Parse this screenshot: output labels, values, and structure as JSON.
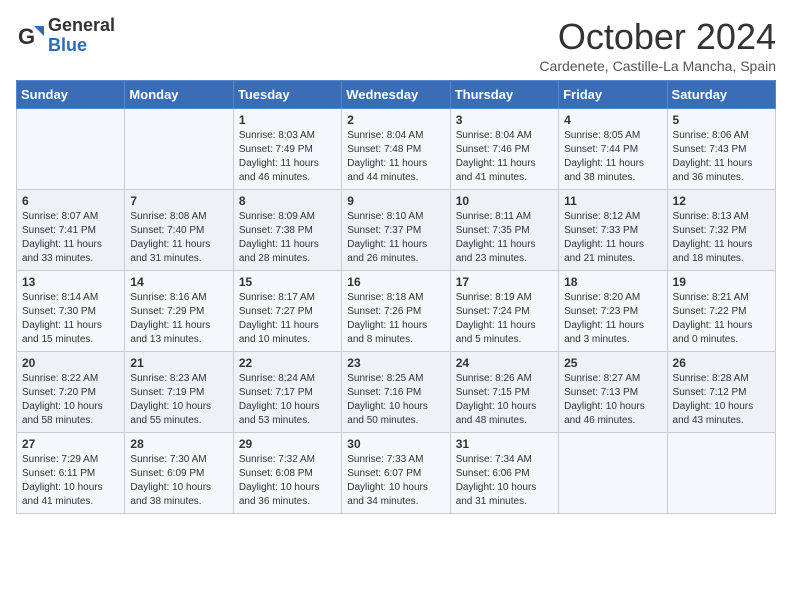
{
  "header": {
    "logo_general": "General",
    "logo_blue": "Blue",
    "month_title": "October 2024",
    "subtitle": "Cardenete, Castille-La Mancha, Spain"
  },
  "days_of_week": [
    "Sunday",
    "Monday",
    "Tuesday",
    "Wednesday",
    "Thursday",
    "Friday",
    "Saturday"
  ],
  "weeks": [
    [
      {
        "day": "",
        "info": ""
      },
      {
        "day": "",
        "info": ""
      },
      {
        "day": "1",
        "info": "Sunrise: 8:03 AM\nSunset: 7:49 PM\nDaylight: 11 hours and 46 minutes."
      },
      {
        "day": "2",
        "info": "Sunrise: 8:04 AM\nSunset: 7:48 PM\nDaylight: 11 hours and 44 minutes."
      },
      {
        "day": "3",
        "info": "Sunrise: 8:04 AM\nSunset: 7:46 PM\nDaylight: 11 hours and 41 minutes."
      },
      {
        "day": "4",
        "info": "Sunrise: 8:05 AM\nSunset: 7:44 PM\nDaylight: 11 hours and 38 minutes."
      },
      {
        "day": "5",
        "info": "Sunrise: 8:06 AM\nSunset: 7:43 PM\nDaylight: 11 hours and 36 minutes."
      }
    ],
    [
      {
        "day": "6",
        "info": "Sunrise: 8:07 AM\nSunset: 7:41 PM\nDaylight: 11 hours and 33 minutes."
      },
      {
        "day": "7",
        "info": "Sunrise: 8:08 AM\nSunset: 7:40 PM\nDaylight: 11 hours and 31 minutes."
      },
      {
        "day": "8",
        "info": "Sunrise: 8:09 AM\nSunset: 7:38 PM\nDaylight: 11 hours and 28 minutes."
      },
      {
        "day": "9",
        "info": "Sunrise: 8:10 AM\nSunset: 7:37 PM\nDaylight: 11 hours and 26 minutes."
      },
      {
        "day": "10",
        "info": "Sunrise: 8:11 AM\nSunset: 7:35 PM\nDaylight: 11 hours and 23 minutes."
      },
      {
        "day": "11",
        "info": "Sunrise: 8:12 AM\nSunset: 7:33 PM\nDaylight: 11 hours and 21 minutes."
      },
      {
        "day": "12",
        "info": "Sunrise: 8:13 AM\nSunset: 7:32 PM\nDaylight: 11 hours and 18 minutes."
      }
    ],
    [
      {
        "day": "13",
        "info": "Sunrise: 8:14 AM\nSunset: 7:30 PM\nDaylight: 11 hours and 15 minutes."
      },
      {
        "day": "14",
        "info": "Sunrise: 8:16 AM\nSunset: 7:29 PM\nDaylight: 11 hours and 13 minutes."
      },
      {
        "day": "15",
        "info": "Sunrise: 8:17 AM\nSunset: 7:27 PM\nDaylight: 11 hours and 10 minutes."
      },
      {
        "day": "16",
        "info": "Sunrise: 8:18 AM\nSunset: 7:26 PM\nDaylight: 11 hours and 8 minutes."
      },
      {
        "day": "17",
        "info": "Sunrise: 8:19 AM\nSunset: 7:24 PM\nDaylight: 11 hours and 5 minutes."
      },
      {
        "day": "18",
        "info": "Sunrise: 8:20 AM\nSunset: 7:23 PM\nDaylight: 11 hours and 3 minutes."
      },
      {
        "day": "19",
        "info": "Sunrise: 8:21 AM\nSunset: 7:22 PM\nDaylight: 11 hours and 0 minutes."
      }
    ],
    [
      {
        "day": "20",
        "info": "Sunrise: 8:22 AM\nSunset: 7:20 PM\nDaylight: 10 hours and 58 minutes."
      },
      {
        "day": "21",
        "info": "Sunrise: 8:23 AM\nSunset: 7:19 PM\nDaylight: 10 hours and 55 minutes."
      },
      {
        "day": "22",
        "info": "Sunrise: 8:24 AM\nSunset: 7:17 PM\nDaylight: 10 hours and 53 minutes."
      },
      {
        "day": "23",
        "info": "Sunrise: 8:25 AM\nSunset: 7:16 PM\nDaylight: 10 hours and 50 minutes."
      },
      {
        "day": "24",
        "info": "Sunrise: 8:26 AM\nSunset: 7:15 PM\nDaylight: 10 hours and 48 minutes."
      },
      {
        "day": "25",
        "info": "Sunrise: 8:27 AM\nSunset: 7:13 PM\nDaylight: 10 hours and 46 minutes."
      },
      {
        "day": "26",
        "info": "Sunrise: 8:28 AM\nSunset: 7:12 PM\nDaylight: 10 hours and 43 minutes."
      }
    ],
    [
      {
        "day": "27",
        "info": "Sunrise: 7:29 AM\nSunset: 6:11 PM\nDaylight: 10 hours and 41 minutes."
      },
      {
        "day": "28",
        "info": "Sunrise: 7:30 AM\nSunset: 6:09 PM\nDaylight: 10 hours and 38 minutes."
      },
      {
        "day": "29",
        "info": "Sunrise: 7:32 AM\nSunset: 6:08 PM\nDaylight: 10 hours and 36 minutes."
      },
      {
        "day": "30",
        "info": "Sunrise: 7:33 AM\nSunset: 6:07 PM\nDaylight: 10 hours and 34 minutes."
      },
      {
        "day": "31",
        "info": "Sunrise: 7:34 AM\nSunset: 6:06 PM\nDaylight: 10 hours and 31 minutes."
      },
      {
        "day": "",
        "info": ""
      },
      {
        "day": "",
        "info": ""
      }
    ]
  ]
}
